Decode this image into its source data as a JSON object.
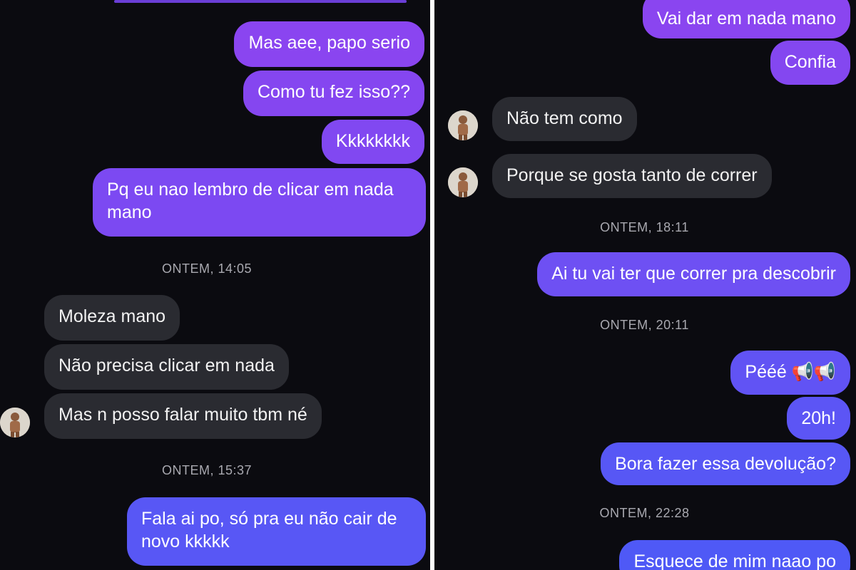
{
  "left": {
    "timestamps": [
      "ONTEM, 14:05",
      "ONTEM, 15:37"
    ],
    "messages": [
      "Mas aee, papo serio",
      "Como tu fez isso??",
      "Kkkkkkkk",
      "Pq eu nao lembro de clicar em nada mano",
      "Moleza mano",
      "Não precisa clicar em nada",
      "Mas n posso falar muito tbm né",
      "Fala ai po, só pra eu não cair de novo kkkkk"
    ]
  },
  "right": {
    "timestamps": [
      "ONTEM, 18:11",
      "ONTEM, 20:11",
      "ONTEM, 22:28"
    ],
    "messages": [
      "Vai dar em nada mano",
      "Confia",
      "Não tem como",
      "Porque se gosta tanto de correr",
      "Ai tu vai ter que correr pra descobrir",
      "Pééé 📢📢",
      "20h!",
      "Bora fazer essa devolução?",
      "Esquece de mim naao po"
    ]
  },
  "colors": {
    "sent_gradient_top": "#8a44f0",
    "sent_gradient_bottom": "#4d5cf6",
    "received": "#2a2b31",
    "background": "#0b0b10"
  },
  "icons": [
    "avatar"
  ]
}
